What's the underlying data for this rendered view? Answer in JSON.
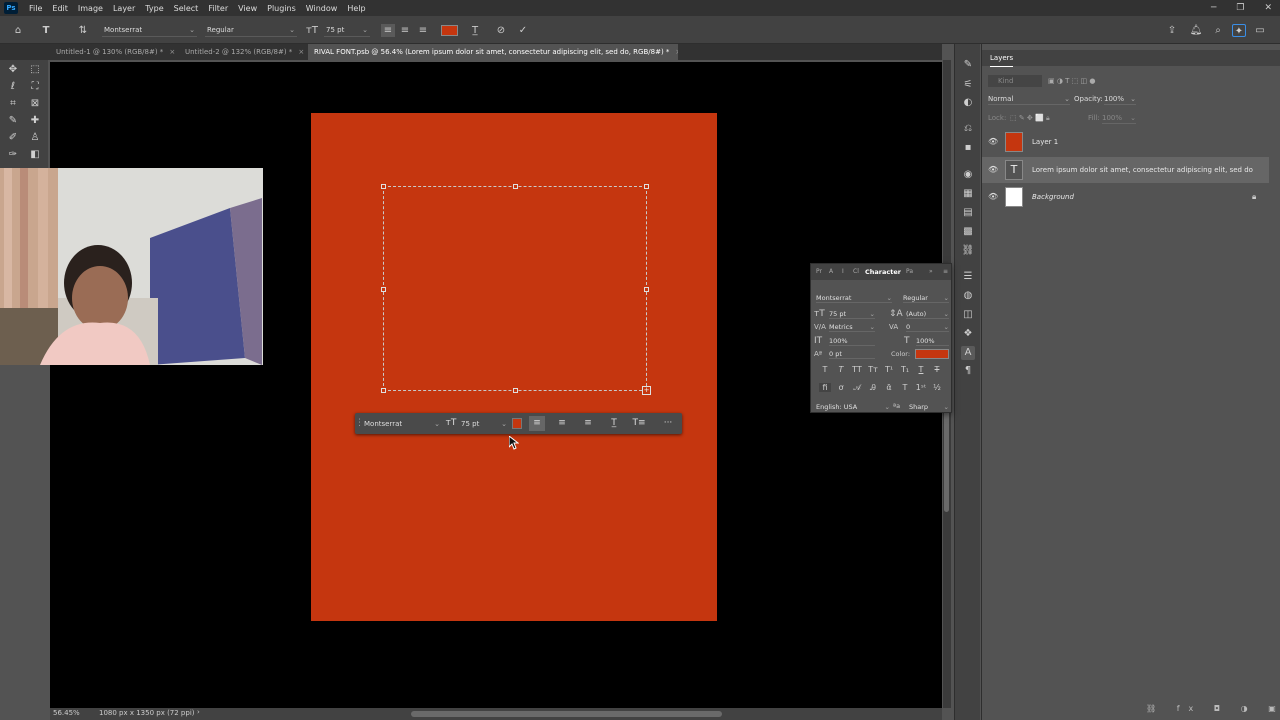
{
  "app": {
    "logo": "Ps"
  },
  "menu": [
    "File",
    "Edit",
    "Image",
    "Layer",
    "Type",
    "Select",
    "Filter",
    "View",
    "Plugins",
    "Window",
    "Help"
  ],
  "window_controls": {
    "minimize": "─",
    "restore": "❐",
    "close": "✕"
  },
  "options_bar": {
    "font_family": "Montserrat",
    "font_style": "Regular",
    "font_size": "75 pt",
    "text_color": "#c5360f",
    "cancel_symbol": "⊘",
    "commit_symbol": "✓"
  },
  "tabs": [
    {
      "label": "Untitled-1 @ 130% (RGB/8#) *",
      "close": "×",
      "active": false
    },
    {
      "label": "Untitled-2 @ 132% (RGB/8#) *",
      "close": "×",
      "active": false
    },
    {
      "label": "RIVAL FONT.psb @ 56.4% (Lorem ipsum dolor sit amet, consectetur adipiscing elit, sed do, RGB/8#) *",
      "close": "×",
      "active": true
    }
  ],
  "contextual_bar": {
    "font_family": "Montserrat",
    "font_size": "75 pt",
    "color": "#c5360f",
    "more_symbol": "···"
  },
  "status": {
    "zoom": "56.45%",
    "doc_info": "1080 px x 1350 px (72 ppi)",
    "arrow": "›"
  },
  "layers_panel": {
    "title": "Layers",
    "search_placeholder": "Kind",
    "blend_mode": "Normal",
    "opacity_label": "Opacity:",
    "opacity_value": "100%",
    "lock_label": "Lock:",
    "fill_label": "Fill:",
    "fill_value": "100%",
    "layers": [
      {
        "name": "Layer 1",
        "thumb_color": "#c5360f",
        "selected": false
      },
      {
        "name": "Lorem ipsum dolor sit amet, consectetur adipiscing elit, sed do",
        "thumb_color": "#535353",
        "is_text": true,
        "selected": true
      },
      {
        "name": "Background",
        "thumb_color": "#ffffff",
        "selected": false,
        "locked": true
      }
    ]
  },
  "character_panel": {
    "tab_title": "Character",
    "other_tabs": [
      "Pr",
      "A",
      "I",
      "Cl",
      "Pa"
    ],
    "font_family": "Montserrat",
    "font_style": "Regular",
    "font_size": "75 pt",
    "leading": "(Auto)",
    "kerning": "Metrics",
    "tracking": "0",
    "vertical_scale": "100%",
    "horizontal_scale": "100%",
    "baseline_shift": "0 pt",
    "color_label": "Color:",
    "color": "#c5360f",
    "language": "English: USA",
    "aa_symbol": "ªa",
    "antialias": "Sharp"
  }
}
